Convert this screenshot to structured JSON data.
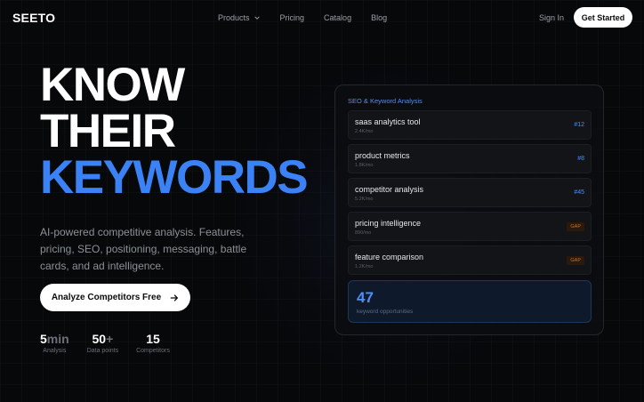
{
  "brand": {
    "logo": "SEETO"
  },
  "nav": {
    "links": [
      "Products",
      "Pricing",
      "Catalog",
      "Blog"
    ],
    "sign_in": "Sign In",
    "cta": "Get Started"
  },
  "hero": {
    "line1": "KNOW",
    "line2": "THEIR",
    "line3": "KEYWORDS",
    "subtitle": "AI-powered competitive analysis. Features, pricing, SEO, positioning, messaging, battle cards, and ad intelligence.",
    "cta": "Analyze Competitors Free",
    "stats": [
      {
        "value": "5",
        "unit": "min",
        "label": "Analysis"
      },
      {
        "value": "50",
        "unit": "+",
        "label": "Data points"
      },
      {
        "value": "15",
        "unit": "",
        "label": "Competitors"
      }
    ]
  },
  "panel": {
    "title": "SEO & Keyword Analysis",
    "keywords": [
      {
        "name": "saas analytics tool",
        "volume": "2.4K/mo",
        "rank": "#12",
        "gap": ""
      },
      {
        "name": "product metrics",
        "volume": "1.8K/mo",
        "rank": "#8",
        "gap": ""
      },
      {
        "name": "competitor analysis",
        "volume": "5.2K/mo",
        "rank": "#45",
        "gap": ""
      },
      {
        "name": "pricing intelligence",
        "volume": "890/mo",
        "rank": "",
        "gap": "GAP"
      },
      {
        "name": "feature comparison",
        "volume": "1.2K/mo",
        "rank": "",
        "gap": "GAP"
      }
    ],
    "opportunities": {
      "count": "47",
      "label": "keyword opportunities"
    }
  },
  "colors": {
    "accent": "#3b82f6",
    "background": "#07080a",
    "gap": "#c2722a"
  }
}
